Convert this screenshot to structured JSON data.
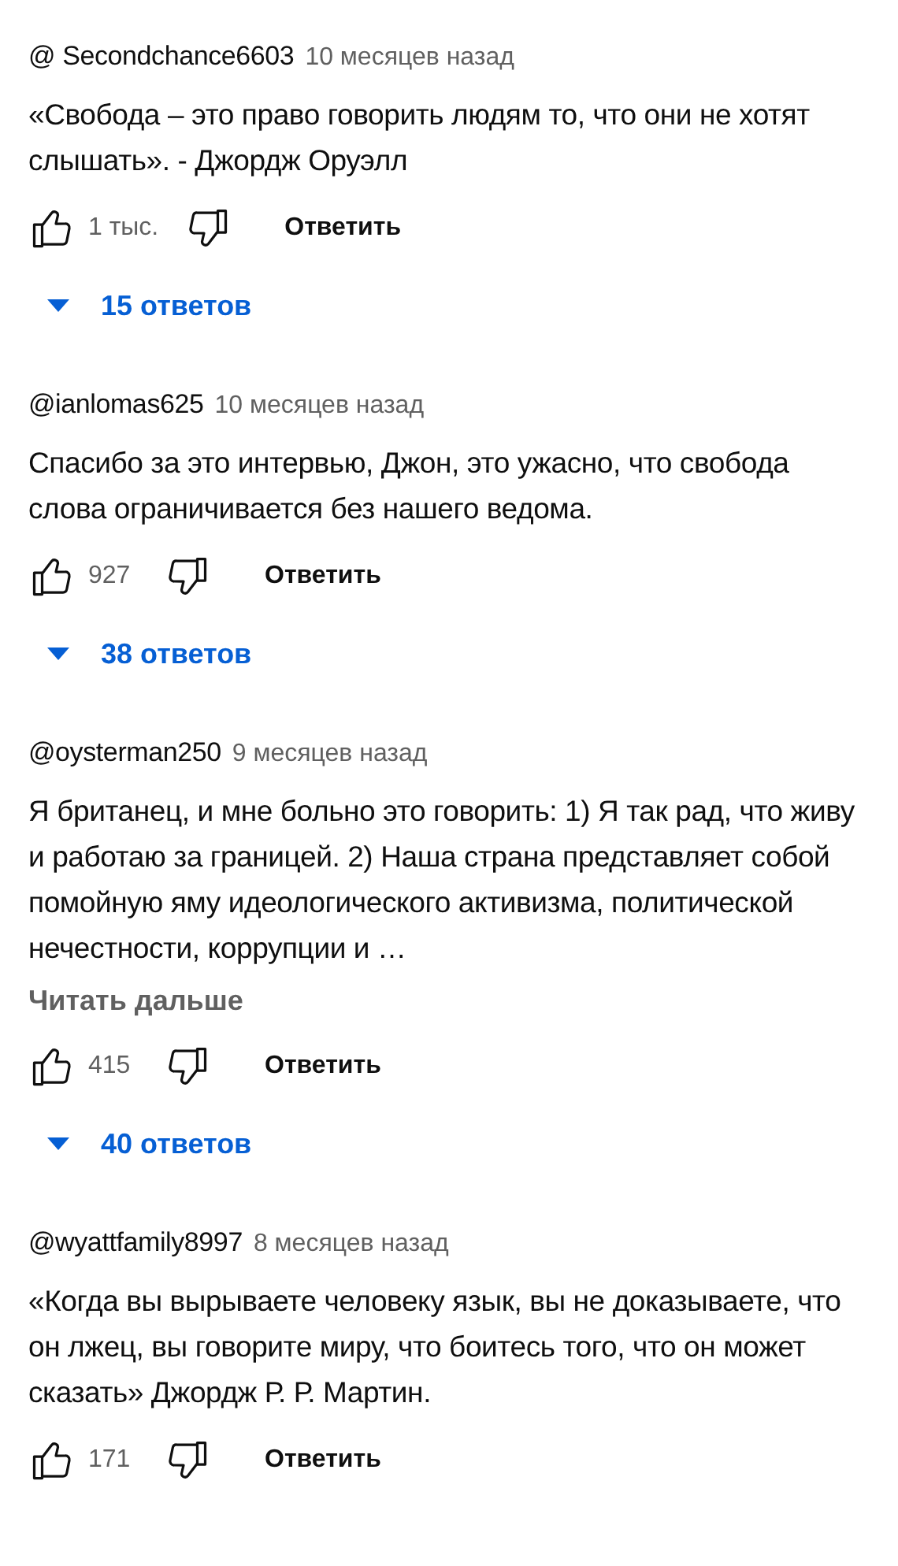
{
  "comments": [
    {
      "author": "@ Secondchance6603",
      "time": "10 месяцев назад",
      "text": "«Свобода – это право говорить людям то, что они не хотят слышать». - Джордж Оруэлл",
      "likes": "1 тыс.",
      "reply_label": "Ответить",
      "replies": "15 ответов"
    },
    {
      "author": "@ianlomas625",
      "time": "10 месяцев назад",
      "text": "Спасибо за это интервью, Джон, это ужасно, что свобода слова ограничивается без нашего ведома.",
      "likes": "927",
      "reply_label": "Ответить",
      "replies": "38 ответов"
    },
    {
      "author": "@oysterman250",
      "time": "9 месяцев назад",
      "text": "Я британец, и мне больно это говорить: 1) Я так рад, что живу и работаю за границей. 2) Наша страна представляет собой помойную яму идеологического активизма, политической нечестности, коррупции и …",
      "read_more": "Читать дальше",
      "likes": "415",
      "reply_label": "Ответить",
      "replies": "40 ответов"
    },
    {
      "author": "@wyattfamily8997",
      "time": "8 месяцев назад",
      "text": "«Когда вы вырываете человеку язык, вы не доказываете, что он лжец, вы говорите миру, что боитесь того, что он может сказать» Джордж Р. Р. Мартин.",
      "likes": "171",
      "reply_label": "Ответить"
    }
  ]
}
